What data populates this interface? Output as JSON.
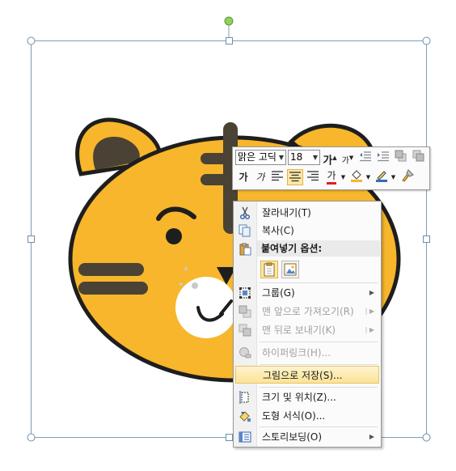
{
  "mini_toolbar": {
    "font_name": "맑은 고딕",
    "font_size": "18",
    "grow_font": "가",
    "shrink_font": "가",
    "bold": "가",
    "italic": "가",
    "font_color_glyph": "가"
  },
  "context_menu": {
    "items": [
      {
        "label": "잘라내기(T)",
        "icon": "scissors-icon",
        "enabled": true
      },
      {
        "label": "복사(C)",
        "icon": "copy-icon",
        "enabled": true
      },
      {
        "label": "붙여넣기 옵션:",
        "icon": "paste-icon",
        "enabled": true
      },
      {
        "label": "그룹(G)",
        "icon": "group-icon",
        "enabled": true
      },
      {
        "label": "맨 앞으로 가져오기(R)",
        "icon": "bring-to-front-icon",
        "enabled": false
      },
      {
        "label": "맨 뒤로 보내기(K)",
        "icon": "send-to-back-icon",
        "enabled": false
      },
      {
        "label": "하이퍼링크(H)...",
        "icon": "hyperlink-icon",
        "enabled": false
      },
      {
        "label": "그림으로 저장(S)...",
        "icon": "",
        "enabled": true
      },
      {
        "label": "크기 및 위치(Z)...",
        "icon": "size-position-icon",
        "enabled": true
      },
      {
        "label": "도형 서식(O)...",
        "icon": "format-shape-icon",
        "enabled": true
      },
      {
        "label": "스토리보딩(O)",
        "icon": "storyboarding-icon",
        "enabled": true
      }
    ],
    "highlighted": "그림으로 저장(S)..."
  },
  "colors": {
    "tiger_orange": "#f7b62b",
    "tiger_dark": "#4a4234",
    "outline": "#1e1e1e",
    "highlight": "#fce394",
    "selection": "#7f9db9",
    "rotate_handle": "#8fd15b"
  }
}
